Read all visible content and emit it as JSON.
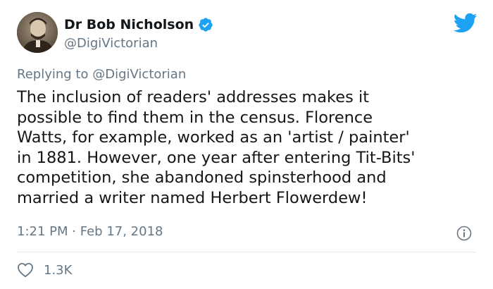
{
  "author": {
    "name": "Dr Bob Nicholson",
    "handle": "@DigiVictorian",
    "verified": true
  },
  "reply": {
    "prefix": "Replying to",
    "mention": "@DigiVictorian"
  },
  "tweet": {
    "lines": [
      "The inclusion of readers' addresses makes it",
      "possible to find them in the census. Florence",
      "Watts, for example, worked as an 'artist / painter'",
      "in 1881. However, one year after entering Tit-Bits'",
      "competition, she abandoned spinsterhood and",
      "married a writer named Herbert Flowerdew!"
    ],
    "time": "1:21 PM",
    "separator": "·",
    "date": "Feb 17, 2018"
  },
  "engagement": {
    "likes": "1.3K"
  },
  "icons": {
    "brand": "twitter-bird-icon",
    "verified": "verified-badge-icon",
    "info": "info-icon",
    "like": "heart-icon"
  },
  "colors": {
    "brand_blue": "#1da1f2",
    "text_primary": "#14171a",
    "text_secondary": "#657786",
    "divider": "#e1e8ed"
  }
}
